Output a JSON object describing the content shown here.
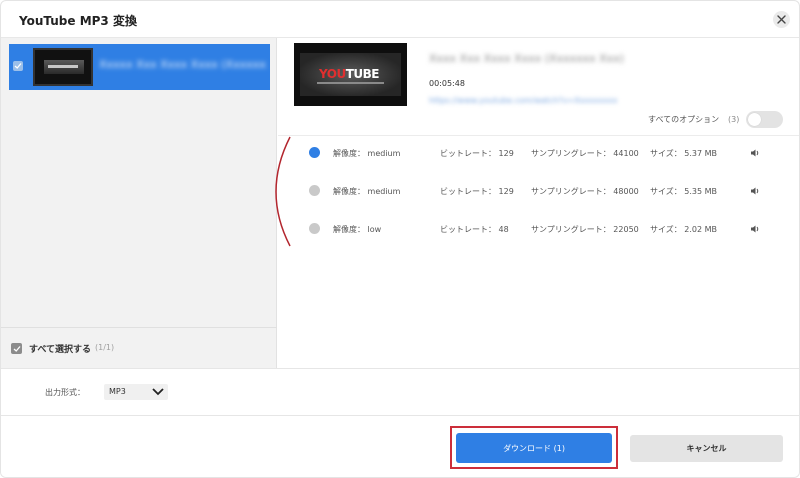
{
  "window": {
    "title": "YouTube MP3 変換"
  },
  "left_panel": {
    "items": [
      {
        "title": "Xxxxx Xxx Xxxx Xxxx (Xxxxxxx)"
      }
    ],
    "select_all_label": "すべて選択する",
    "select_all_count": "(1/1)"
  },
  "detail": {
    "thumb_logo_a": "YOU",
    "thumb_logo_b": "TUBE",
    "title": "Xxxx Xxx Xxxx Xxxx (Xxxxxxx Xxx)",
    "duration": "00:05:48",
    "url": "https://www.youtube.com/watch?v=Xxxxxxxxx",
    "options_label": "すべてのオプション",
    "options_count": "(3)"
  },
  "formats": [
    {
      "res": "解像度： medium",
      "bitrate": "ビットレート： 129",
      "sample": "サンプリングレート： 44100",
      "size": "サイズ： 5.37 MB",
      "selected": true
    },
    {
      "res": "解像度： medium",
      "bitrate": "ビットレート： 129",
      "sample": "サンプリングレート： 48000",
      "size": "サイズ： 5.35 MB",
      "selected": false
    },
    {
      "res": "解像度： low",
      "bitrate": "ビットレート： 48",
      "sample": "サンプリングレート： 22050",
      "size": "サイズ： 2.02 MB",
      "selected": false
    }
  ],
  "output": {
    "label": "出力形式：",
    "value": "MP3"
  },
  "footer": {
    "download_label": "ダウンロード (1)",
    "cancel_label": "キャンセル"
  },
  "colors": {
    "accent": "#2f7fe4",
    "highlight": "#cc2e3a"
  },
  "icons": {
    "close": "close-icon",
    "check": "check-icon",
    "speaker": "speaker-icon",
    "dropdown": "chevron-down-icon"
  }
}
